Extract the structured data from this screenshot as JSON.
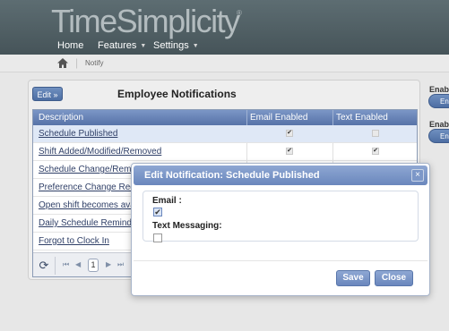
{
  "app": {
    "logo": "TimeSimplicity",
    "logo_mark": "®"
  },
  "nav": [
    {
      "label": "Home",
      "has_menu": false
    },
    {
      "label": "Features",
      "has_menu": true
    },
    {
      "label": "Settings",
      "has_menu": true
    }
  ],
  "breadcrumb": {
    "current": "Notify",
    "home_icon": "home-icon",
    "separator": "|"
  },
  "panel": {
    "edit_label": "Edit »",
    "title": "Employee Notifications",
    "columns": [
      "Description",
      "Email Enabled",
      "Text Enabled"
    ],
    "rows": [
      {
        "desc": "Schedule Published",
        "email": true,
        "text": false,
        "selected": true
      },
      {
        "desc": "Shift Added/Modified/Removed",
        "email": true,
        "text": true,
        "selected": false
      },
      {
        "desc": "Schedule Change/Remo",
        "email": true,
        "text": true,
        "selected": false
      },
      {
        "desc": "Preference Change Req",
        "email": false,
        "text": false,
        "selected": false
      },
      {
        "desc": "Open shift becomes ava",
        "email": false,
        "text": false,
        "selected": false
      },
      {
        "desc": "Daily Schedule Reminde",
        "email": false,
        "text": false,
        "selected": false
      },
      {
        "desc": "Forgot to Clock In",
        "email": false,
        "text": false,
        "selected": false
      }
    ],
    "pager": {
      "page": "1",
      "first": "⏮",
      "prev": "◀",
      "next": "▶",
      "last": "⏭",
      "refresh_icon": "refresh-icon"
    }
  },
  "side": {
    "label1": "Enable",
    "pill1": "En",
    "label2": "Enable",
    "pill2": "En"
  },
  "dialog": {
    "title": "Edit Notification: Schedule Published",
    "email_label": "Email :",
    "email_checked": true,
    "text_label": "Text Messaging:",
    "text_checked": false,
    "save_label": "Save",
    "close_label": "Close",
    "close_icon": "×"
  },
  "colors": {
    "header_bg": "#4f5e63",
    "accent": "#6a87bd",
    "grid_header": "#6a86b8"
  }
}
